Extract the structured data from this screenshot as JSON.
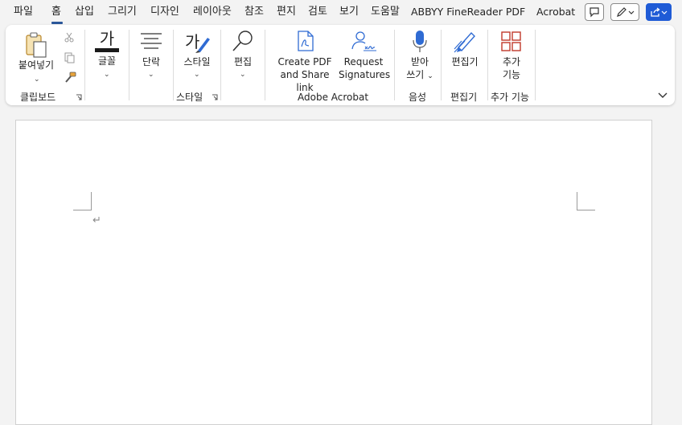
{
  "tabs": [
    {
      "label": "파일"
    },
    {
      "label": "홈"
    },
    {
      "label": "삽입"
    },
    {
      "label": "그리기"
    },
    {
      "label": "디자인"
    },
    {
      "label": "레이아웃"
    },
    {
      "label": "참조"
    },
    {
      "label": "편지"
    },
    {
      "label": "검토"
    },
    {
      "label": "보기"
    },
    {
      "label": "도움말"
    },
    {
      "label": "ABBYY FineReader PDF"
    },
    {
      "label": "Acrobat"
    }
  ],
  "active_tab": "홈",
  "ribbon": {
    "paste_label": "붙여넣기",
    "clipboard_group": "클립보드",
    "font_label": "글꼴",
    "paragraph_label": "단락",
    "styles_label": "스타일",
    "styles_group": "스타일",
    "edit_label": "편집",
    "create_pdf_line1": "Create PDF",
    "create_pdf_line2": "and Share link",
    "request_sig_line1": "Request",
    "request_sig_line2": "Signatures",
    "adobe_group": "Adobe Acrobat",
    "dictate_line1": "받아",
    "dictate_line2": "쓰기",
    "voice_group": "음성",
    "editor_label": "편집기",
    "editor_group": "편집기",
    "addins_line1": "추가",
    "addins_line2": "기능",
    "addins_group": "추가 기능"
  },
  "colors": {
    "accent": "#2b579a",
    "share": "#1f5bd6",
    "paste_icon": "#d4a33a",
    "icon_blue": "#2f6bd3",
    "addins_red": "#c0392b"
  },
  "icons": [
    "clipboard-paste-icon",
    "scissors-icon",
    "copy-icon",
    "format-painter-icon",
    "font-icon",
    "paragraph-icon",
    "styles-icon",
    "search-icon",
    "create-pdf-icon",
    "request-signature-icon",
    "microphone-icon",
    "editor-pen-icon",
    "addins-grid-icon",
    "comment-icon",
    "pen-edit-icon",
    "share-icon",
    "collapse-ribbon-icon"
  ]
}
